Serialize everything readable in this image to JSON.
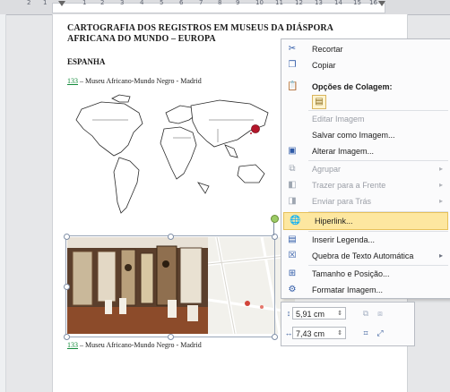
{
  "ruler": {
    "numbers": [
      "2",
      "1",
      "1",
      "2",
      "3",
      "4",
      "5",
      "6",
      "7",
      "8",
      "9",
      "10",
      "11",
      "12",
      "13",
      "14",
      "15",
      "16"
    ]
  },
  "document": {
    "title": "CARTOGRAFIA DOS REGISTROS EM MUSEUS DA DIÁSPORA AFRICANA DO MUNDO – EUROPA",
    "section": "ESPANHA",
    "caption_top_num": "133",
    "caption_top_rest": " – Museu Africano-Mundo Negro - Madrid",
    "caption_bottom_num": "133",
    "caption_bottom_rest": " – Museu Africano-Mundo Negro - Madrid"
  },
  "context_menu": {
    "items": [
      {
        "label": "Recortar",
        "icon": "scissors-icon",
        "glyph": "✂",
        "disabled": false,
        "submenu": false
      },
      {
        "label": "Copiar",
        "icon": "copy-icon",
        "glyph": "❐",
        "disabled": false,
        "submenu": false
      },
      {
        "label": "Editar Imagem",
        "icon": "",
        "glyph": "",
        "disabled": true,
        "submenu": false
      },
      {
        "label": "Salvar como Imagem...",
        "icon": "",
        "glyph": "",
        "disabled": false,
        "submenu": false
      },
      {
        "label": "Alterar Imagem...",
        "icon": "change-picture-icon",
        "glyph": "▣",
        "disabled": false,
        "submenu": false
      },
      {
        "label": "Agrupar",
        "icon": "group-icon",
        "glyph": "⧉",
        "disabled": true,
        "submenu": true
      },
      {
        "label": "Trazer para a Frente",
        "icon": "bring-forward-icon",
        "glyph": "◧",
        "disabled": true,
        "submenu": true
      },
      {
        "label": "Enviar para Trás",
        "icon": "send-backward-icon",
        "glyph": "◨",
        "disabled": true,
        "submenu": true
      },
      {
        "label": "Hiperlink...",
        "icon": "hyperlink-icon",
        "glyph": "🌐",
        "disabled": false,
        "submenu": false,
        "highlighted": true
      },
      {
        "label": "Inserir Legenda...",
        "icon": "insert-caption-icon",
        "glyph": "▤",
        "disabled": false,
        "submenu": false
      },
      {
        "label": "Quebra de Texto Automática",
        "icon": "wrap-text-icon",
        "glyph": "☒",
        "disabled": false,
        "submenu": true
      },
      {
        "label": "Tamanho e Posição...",
        "icon": "size-position-icon",
        "glyph": "⊞",
        "disabled": false,
        "submenu": false
      },
      {
        "label": "Formatar Imagem...",
        "icon": "format-picture-icon",
        "glyph": "⚙",
        "disabled": false,
        "submenu": false
      }
    ],
    "paste_header": "Opções de Colagem:"
  },
  "mini_toolbar": {
    "height_value": "5,91 cm",
    "width_value": "7,43 cm"
  },
  "colors": {
    "highlight": "#fde7a0",
    "caption_number": "#128a3a",
    "map_marker": "#b5162b"
  }
}
